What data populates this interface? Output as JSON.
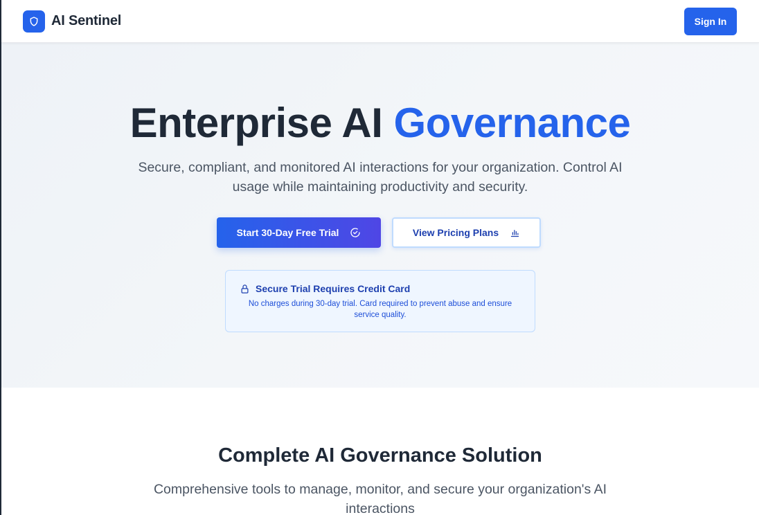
{
  "navbar": {
    "brand_name": "AI Sentinel",
    "logo_icon": "shield-icon",
    "signin_label": "Sign In"
  },
  "hero": {
    "title_main": "Enterprise AI ",
    "title_accent": "Governance",
    "subtitle": "Secure, compliant, and monitored AI interactions for your organization. Control AI usage while maintaining productivity and security.",
    "primary_cta": {
      "label": "Start 30-Day Free Trial",
      "icon": "check-circle-icon"
    },
    "secondary_cta": {
      "label": "View Pricing Plans",
      "icon": "bar-chart-icon"
    },
    "notice": {
      "icon": "lock-icon",
      "title": "Secure Trial Requires Credit Card",
      "text": "No charges during 30-day trial. Card required to prevent abuse and ensure service quality."
    }
  },
  "features": {
    "title": "Complete AI Governance Solution",
    "subtitle": "Comprehensive tools to manage, monitor, and secure your organization's AI interactions"
  },
  "colors": {
    "primary": "#2563eb",
    "primary_gradient_end": "#4f46e5",
    "text_dark": "#1f2937",
    "text_muted": "#4b5563",
    "notice_bg": "#eff6ff",
    "notice_border": "#bfdbfe"
  }
}
